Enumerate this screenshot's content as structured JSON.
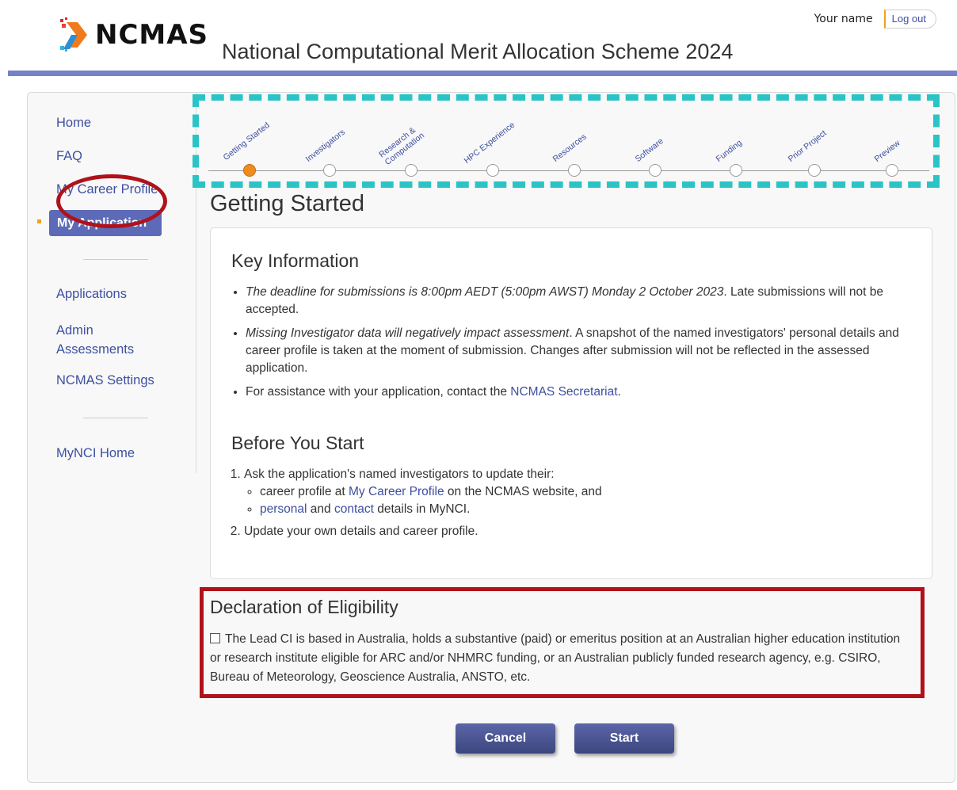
{
  "header": {
    "user_name": "Your name",
    "logout_label": "Log out",
    "logo_text": "NCMAS",
    "site_title": "National Computational Merit Allocation Scheme 2024"
  },
  "sidebar": {
    "items": [
      {
        "label": "Home"
      },
      {
        "label": "FAQ"
      },
      {
        "label": "My Career Profile"
      },
      {
        "label": "My Application",
        "active": true
      },
      {
        "label": "Applications"
      },
      {
        "label": "Admin Assessments"
      },
      {
        "label": "NCMAS Settings"
      },
      {
        "label": "MyNCI Home"
      }
    ]
  },
  "stepper": {
    "steps": [
      {
        "label": "Getting Started",
        "current": true
      },
      {
        "label": "Investigators"
      },
      {
        "label": "Research & Computation"
      },
      {
        "label": "HPC Experience"
      },
      {
        "label": "Resources"
      },
      {
        "label": "Software"
      },
      {
        "label": "Funding"
      },
      {
        "label": "Prior Project"
      },
      {
        "label": "Preview"
      }
    ]
  },
  "page": {
    "heading": "Getting Started"
  },
  "key_info": {
    "title": "Key Information",
    "deadline_em": "The deadline for submissions is 8:00pm AEDT (5:00pm AWST) Monday 2 October 2023",
    "deadline_rest": ". Late submissions will not be accepted.",
    "missing_em": "Missing Investigator data will negatively impact assessment",
    "missing_rest": ". A snapshot of the named investigators' personal details and career profile is taken at the moment of submission. Changes after submission will not be reflected in the assessed application.",
    "assist_text": "For assistance with your application, contact the ",
    "assist_link": "NCMAS Secretariat",
    "assist_end": "."
  },
  "before_start": {
    "title": "Before You Start",
    "step1": "Ask the application's named investigators to update their:",
    "sub1_pre": "career profile at ",
    "sub1_link": "My Career Profile",
    "sub1_post": " on the NCMAS website, and",
    "sub2_link1": "personal",
    "sub2_mid": " and ",
    "sub2_link2": "contact",
    "sub2_post": " details in MyNCI.",
    "step2": "Update your own details and career profile."
  },
  "declaration": {
    "title": "Declaration of Eligibility",
    "text": "The Lead CI is based in Australia, holds a substantive (paid) or emeritus position at an Australian higher education institution or research institute eligible for ARC and/or NHMRC funding, or an Australian publicly funded research agency, e.g. CSIRO, Bureau of Meteorology, Geoscience Australia, ANSTO, etc.",
    "checked": false
  },
  "actions": {
    "cancel_label": "Cancel",
    "start_label": "Start"
  },
  "colors": {
    "accent": "#5c6ab8",
    "link": "#3d4fa0",
    "highlight_red": "#b0121a",
    "highlight_teal": "#2bc4c6",
    "current_step": "#f08c1e"
  }
}
